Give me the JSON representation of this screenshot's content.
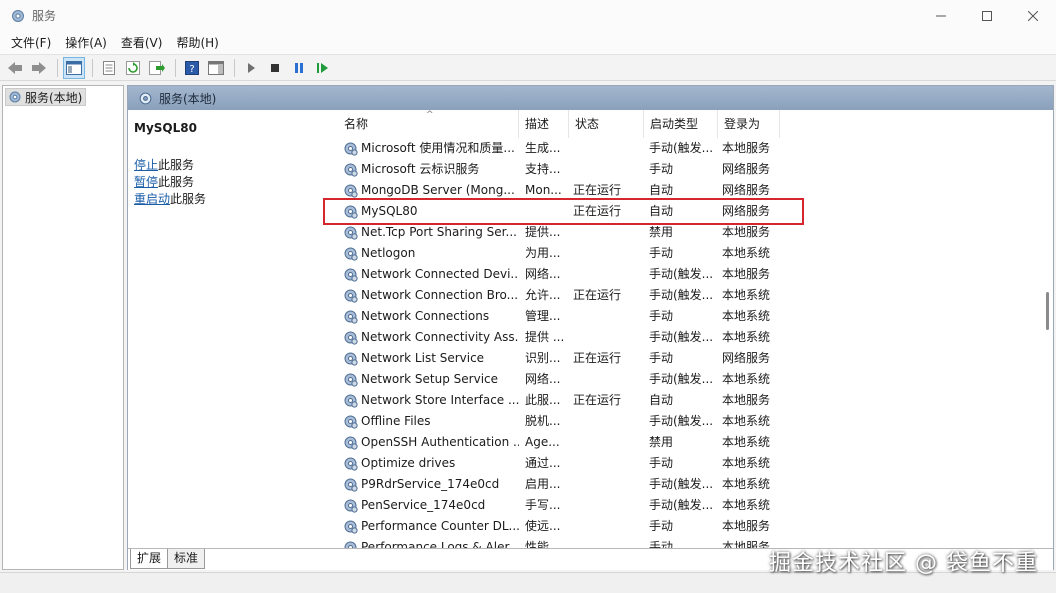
{
  "window": {
    "title": "服务"
  },
  "menu": [
    "文件(F)",
    "操作(A)",
    "查看(V)",
    "帮助(H)"
  ],
  "tree": {
    "root": "服务(本地)"
  },
  "header": {
    "title": "服务(本地)"
  },
  "detail": {
    "service_name": "MySQL80",
    "actions": [
      {
        "link": "停止",
        "rest": "此服务"
      },
      {
        "link": "暂停",
        "rest": "此服务"
      },
      {
        "link": "重启动",
        "rest": "此服务"
      }
    ]
  },
  "columns": [
    "名称",
    "描述",
    "状态",
    "启动类型",
    "登录为"
  ],
  "rows": [
    {
      "name": "Microsoft 使用情况和质量...",
      "desc": "生成...",
      "status": "",
      "startup": "手动(触发...",
      "logon": "本地服务"
    },
    {
      "name": "Microsoft 云标识服务",
      "desc": "支持...",
      "status": "",
      "startup": "手动",
      "logon": "网络服务"
    },
    {
      "name": "MongoDB Server (Mong...",
      "desc": "Mon...",
      "status": "正在运行",
      "startup": "自动",
      "logon": "网络服务"
    },
    {
      "name": "MySQL80",
      "desc": "",
      "status": "正在运行",
      "startup": "自动",
      "logon": "网络服务"
    },
    {
      "name": "Net.Tcp Port Sharing Ser...",
      "desc": "提供...",
      "status": "",
      "startup": "禁用",
      "logon": "本地服务"
    },
    {
      "name": "Netlogon",
      "desc": "为用...",
      "status": "",
      "startup": "手动",
      "logon": "本地系统"
    },
    {
      "name": "Network Connected Devi...",
      "desc": "网络...",
      "status": "",
      "startup": "手动(触发...",
      "logon": "本地服务"
    },
    {
      "name": "Network Connection Bro...",
      "desc": "允许...",
      "status": "正在运行",
      "startup": "手动(触发...",
      "logon": "本地系统"
    },
    {
      "name": "Network Connections",
      "desc": "管理...",
      "status": "",
      "startup": "手动",
      "logon": "本地系统"
    },
    {
      "name": "Network Connectivity Ass...",
      "desc": "提供 ...",
      "status": "",
      "startup": "手动(触发...",
      "logon": "本地系统"
    },
    {
      "name": "Network List Service",
      "desc": "识别...",
      "status": "正在运行",
      "startup": "手动",
      "logon": "网络服务"
    },
    {
      "name": "Network Setup Service",
      "desc": "网络...",
      "status": "",
      "startup": "手动(触发...",
      "logon": "本地系统"
    },
    {
      "name": "Network Store Interface ...",
      "desc": "此服...",
      "status": "正在运行",
      "startup": "自动",
      "logon": "本地服务"
    },
    {
      "name": "Offline Files",
      "desc": "脱机...",
      "status": "",
      "startup": "手动(触发...",
      "logon": "本地系统"
    },
    {
      "name": "OpenSSH Authentication ...",
      "desc": "Age...",
      "status": "",
      "startup": "禁用",
      "logon": "本地系统"
    },
    {
      "name": "Optimize drives",
      "desc": "通过...",
      "status": "",
      "startup": "手动",
      "logon": "本地系统"
    },
    {
      "name": "P9RdrService_174e0cd",
      "desc": "启用...",
      "status": "",
      "startup": "手动(触发...",
      "logon": "本地系统"
    },
    {
      "name": "PenService_174e0cd",
      "desc": "手写...",
      "status": "",
      "startup": "手动(触发...",
      "logon": "本地系统"
    },
    {
      "name": "Performance Counter DL...",
      "desc": "使远...",
      "status": "",
      "startup": "手动",
      "logon": "本地服务"
    },
    {
      "name": "Performance Logs & Aler...",
      "desc": "性能...",
      "status": "",
      "startup": "手动",
      "logon": "本地服务"
    }
  ],
  "tabs": [
    "扩展",
    "标准"
  ],
  "watermark": "掘金技术社区 @ 袋鱼不重",
  "colors": {
    "highlight_border": "#d5262e",
    "link": "#1a5ea8",
    "header_strip": "#9cb0c8"
  }
}
